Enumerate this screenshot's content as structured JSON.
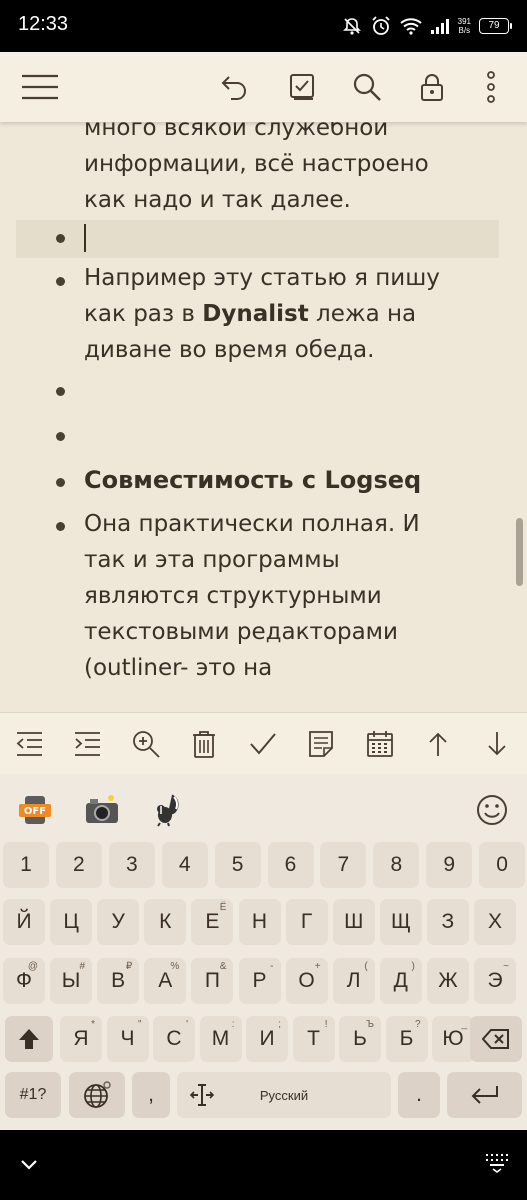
{
  "status_bar": {
    "time": "12:33",
    "net_speed_value": "391",
    "net_speed_unit": "B/s",
    "battery": "79"
  },
  "app_bar": {
    "icons": [
      "menu-icon",
      "undo-icon",
      "checklist-icon",
      "search-icon",
      "lock-icon",
      "more-vert-icon"
    ]
  },
  "document": {
    "items": [
      {
        "type": "text",
        "lines": [
          "много всякой служебной",
          "информации, всё настроено",
          "как надо и так далее."
        ]
      },
      {
        "type": "empty-active"
      },
      {
        "type": "rich",
        "line1": "Например эту статью я пишу",
        "line2_pre": "как раз в ",
        "line2_bold": "Dynalist",
        "line2_post": " лежа на",
        "line3": "диване во время обеда."
      },
      {
        "type": "empty"
      },
      {
        "type": "empty"
      },
      {
        "type": "heading",
        "text": "Совместимость с Logseq"
      },
      {
        "type": "text",
        "lines": [
          "Она практически полная. И",
          "так и эта программы",
          "являются структурными",
          "текстовыми редакторами",
          "(outliner- это на"
        ]
      }
    ]
  },
  "edit_toolbar": {
    "icons": [
      "outdent-icon",
      "indent-icon",
      "zoom-in-icon",
      "delete-icon",
      "check-icon",
      "note-icon",
      "calendar-icon",
      "move-up-icon",
      "move-down-icon"
    ]
  },
  "keyboard": {
    "suggestions": [
      "off-icon",
      "camera-icon",
      "skunk-icon",
      "emoji-icon"
    ],
    "numbers": [
      "1",
      "2",
      "3",
      "4",
      "5",
      "6",
      "7",
      "8",
      "9",
      "0"
    ],
    "row1": [
      "Й",
      "Ц",
      "У",
      "К",
      "Е",
      "Н",
      "Г",
      "Ш",
      "Щ",
      "З",
      "Х"
    ],
    "row1_sup": [
      "",
      "",
      "",
      "",
      "Ё",
      "",
      "",
      "",
      "",
      "",
      ""
    ],
    "row2": [
      "Ф",
      "Ы",
      "В",
      "А",
      "П",
      "Р",
      "О",
      "Л",
      "Д",
      "Ж",
      "Э"
    ],
    "row2_sup": [
      "@",
      "#",
      "₽",
      "%",
      "&",
      "-",
      "+",
      "(",
      ")",
      "",
      "~"
    ],
    "row3": [
      "Я",
      "Ч",
      "С",
      "М",
      "И",
      "Т",
      "Ь",
      "Б",
      "Ю"
    ],
    "row3_sup": [
      "*",
      "\"",
      "'",
      ":",
      ";",
      "!",
      "Ъ",
      "?",
      "_"
    ],
    "symbols_label": "#1?",
    "comma": ",",
    "space_label": "Русский",
    "period": "."
  }
}
